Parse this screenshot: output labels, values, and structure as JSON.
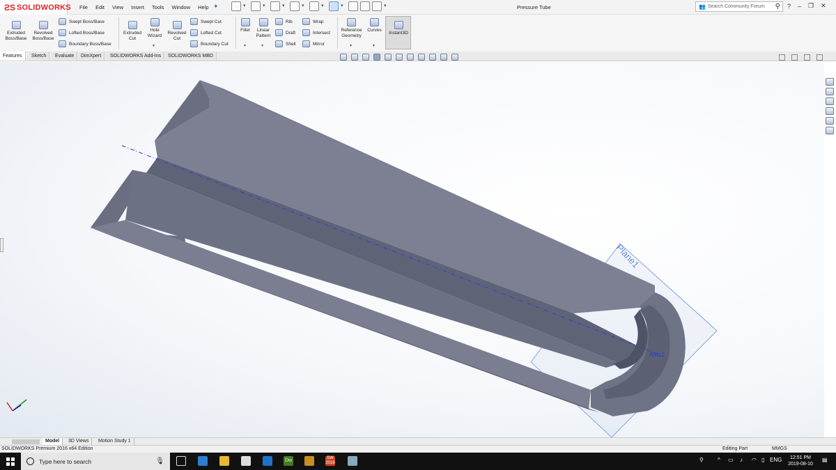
{
  "app": {
    "brand": "SOLIDWORKS",
    "document_title": "Pressure Tube",
    "menus": [
      "File",
      "Edit",
      "View",
      "Insert",
      "Tools",
      "Window",
      "Help"
    ]
  },
  "search": {
    "placeholder": "Search Community Forum"
  },
  "ribbon": {
    "extruded_boss": "Extruded Boss/Base",
    "revolved_boss": "Revolved Boss/Base",
    "swept_boss": "Swept Boss/Base",
    "lofted_boss": "Lofted Boss/Base",
    "boundary_boss": "Boundary Boss/Base",
    "extruded_cut": "Extruded Cut",
    "hole_wizard": "Hole Wizard",
    "revolved_cut": "Revolved Cut",
    "swept_cut": "Swept Cut",
    "lofted_cut": "Lofted Cut",
    "boundary_cut": "Boundary Cut",
    "fillet": "Fillet",
    "linear_pattern": "Linear Pattern",
    "rib": "Rib",
    "draft": "Draft",
    "shell": "Shell",
    "wrap": "Wrap",
    "intersect": "Intersect",
    "mirror": "Mirror",
    "reference_geometry": "Reference Geometry",
    "curves": "Curves",
    "instant3d": "Instant3D"
  },
  "tabs": [
    "Features",
    "Sketch",
    "Evaluate",
    "DimXpert",
    "SOLIDWORKS Add-Ins",
    "SOLIDWORKS MBD"
  ],
  "viewport": {
    "plane_label": "Plane1",
    "axis_label": "Axis1"
  },
  "model_tabs": [
    "Model",
    "3D Views",
    "Motion Study 1"
  ],
  "status": {
    "edition": "SOLIDWORKS Premium 2016 x64 Edition",
    "mode": "Editing Part",
    "units": "MMGS"
  },
  "taskbar": {
    "search_placeholder": "Type here to search",
    "dw_label": "Dw",
    "sw_label": "SW",
    "sw_year": "2016",
    "language": "ENG",
    "time": "12:51 PM",
    "date": "2019-08-10"
  },
  "colors": {
    "part_face_top": "#7b7f90",
    "part_face_side": "#5c6073",
    "plane_outline": "#6a8fd8",
    "axis_line": "#2a3fd0",
    "brand_red": "#d22222"
  }
}
